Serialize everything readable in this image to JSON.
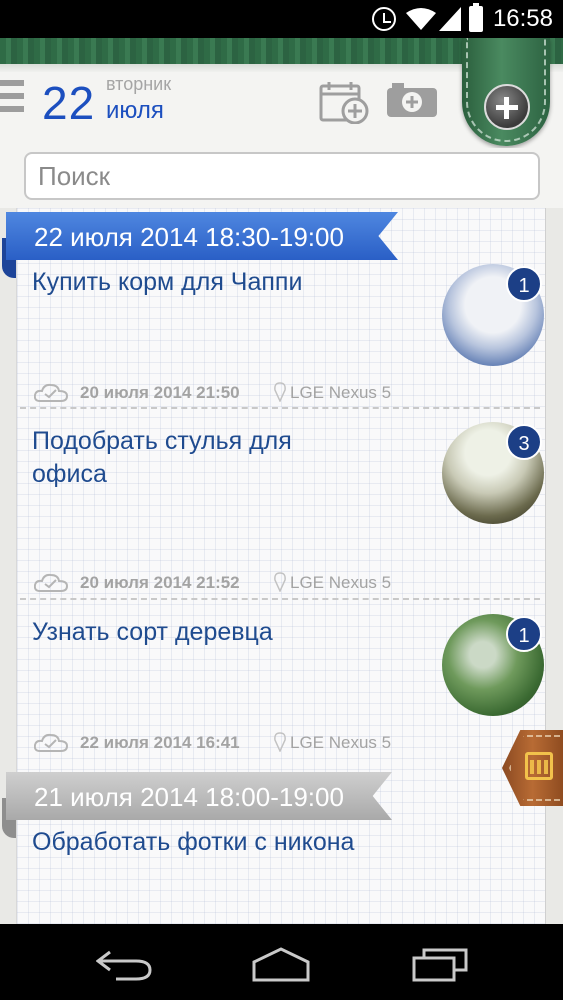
{
  "status_bar": {
    "time": "16:58"
  },
  "header": {
    "day": "22",
    "weekday": "вторник",
    "month": "июля"
  },
  "search": {
    "placeholder": "Поиск"
  },
  "groups": [
    {
      "header": "22 июля 2014 18:30-19:00",
      "color": "#2a5fc6",
      "tasks": [
        {
          "title": "Купить корм для Чаппи",
          "count": "1",
          "date": "20 июля 2014 21:50",
          "device": "LGE Nexus 5"
        },
        {
          "title": "Подобрать стулья для офиса",
          "count": "3",
          "date": "20 июля 2014 21:52",
          "device": "LGE Nexus 5"
        },
        {
          "title": "Узнать сорт деревца",
          "count": "1",
          "date": "22 июля 2014 16:41",
          "device": "LGE Nexus 5"
        }
      ]
    },
    {
      "header": "21 июля 2014 18:00-19:00",
      "color": "#a9a9a9",
      "tasks": [
        {
          "title": "Обработать фотки с никона"
        }
      ]
    }
  ],
  "icons": {
    "alarm": "alarm-icon",
    "wifi": "wifi-icon",
    "signal": "signal-icon",
    "battery": "battery-icon",
    "menu": "menu-icon",
    "add_event": "add-event-icon",
    "camera": "camera-icon",
    "add": "plus-icon",
    "sync": "cloud-icon",
    "location": "pin-icon",
    "calendar": "calendar-icon",
    "back": "back-icon",
    "home": "home-icon",
    "recents": "recents-icon"
  }
}
